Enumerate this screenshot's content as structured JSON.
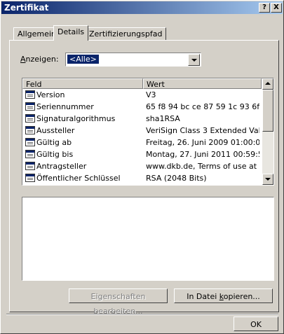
{
  "window": {
    "title": "Zertifikat",
    "help_btn": "?",
    "close_btn": "X"
  },
  "tabs": [
    {
      "label": "Allgemein"
    },
    {
      "label": "Details"
    },
    {
      "label": "Zertifizierungspfad"
    }
  ],
  "show": {
    "label_prefix": "A",
    "label_rest": "nzeigen:",
    "value": "<Alle>"
  },
  "list": {
    "col_field": "Feld",
    "col_value": "Wert",
    "rows": [
      {
        "field": "Version",
        "value": "V3"
      },
      {
        "field": "Seriennummer",
        "value": "65 f8 94 bc ce 87 59 1c 93 6f ..."
      },
      {
        "field": "Signaturalgorithmus",
        "value": "sha1RSA"
      },
      {
        "field": "Aussteller",
        "value": "VeriSign Class 3 Extended Vali..."
      },
      {
        "field": "Gültig ab",
        "value": "Freitag, 26. Juni 2009 01:00:00"
      },
      {
        "field": "Gültig bis",
        "value": "Montag, 27. Juni 2011 00:59:59"
      },
      {
        "field": "Antragsteller",
        "value": "www.dkb.de, Terms of use at ..."
      },
      {
        "field": "Öffentlicher Schlüssel",
        "value": "RSA (2048 Bits)"
      }
    ]
  },
  "buttons": {
    "edit_label": "Eigenschaften bearbeiten...",
    "copy_label_pre": "In Datei ",
    "copy_label_key": "k",
    "copy_label_post": "opieren...",
    "ok_label": "OK"
  }
}
